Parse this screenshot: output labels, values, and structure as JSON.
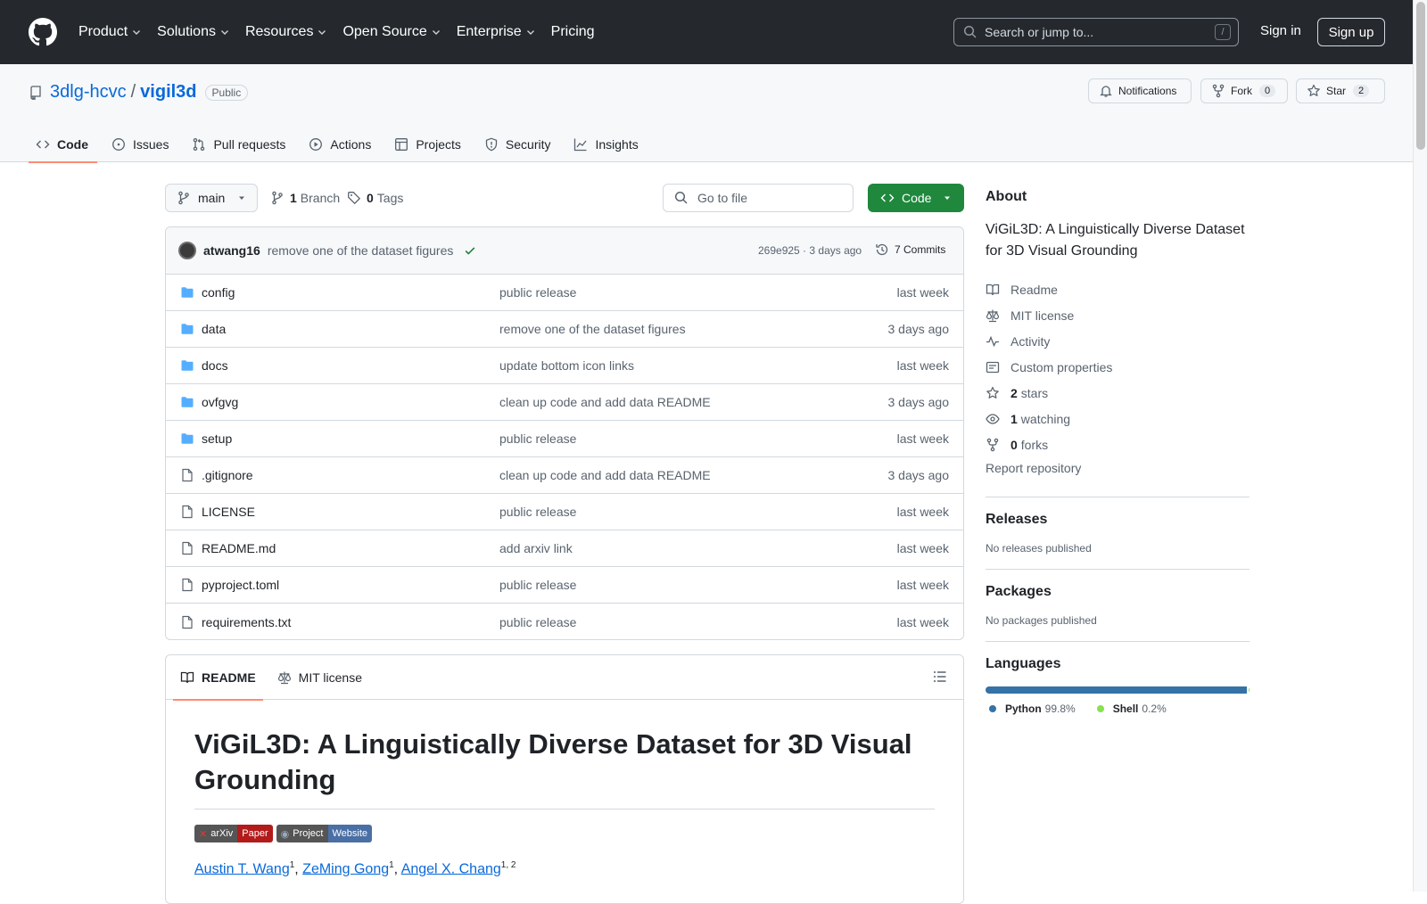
{
  "header": {
    "nav": [
      "Product",
      "Solutions",
      "Resources",
      "Open Source",
      "Enterprise",
      "Pricing"
    ],
    "search_placeholder": "Search or jump to...",
    "search_shortcut": "/",
    "signin": "Sign in",
    "signup": "Sign up"
  },
  "repo": {
    "owner": "3dlg-hcvc",
    "separator": "/",
    "name": "vigil3d",
    "visibility": "Public",
    "notifications_label": "Notifications",
    "fork_label": "Fork",
    "fork_count": "0",
    "star_label": "Star",
    "star_count": "2"
  },
  "tabs": [
    "Code",
    "Issues",
    "Pull requests",
    "Actions",
    "Projects",
    "Security",
    "Insights"
  ],
  "toolbar": {
    "branch": "main",
    "branch_count": "1",
    "branch_label": "Branch",
    "tag_count": "0",
    "tag_label": "Tags",
    "goto_placeholder": "Go to file",
    "code_label": "Code"
  },
  "commit": {
    "author": "atwang16",
    "message": "remove one of the dataset figures",
    "meta": "269e925 · 3 days ago",
    "commits": "7 Commits"
  },
  "files": [
    {
      "name": "config",
      "type": "dir",
      "message": "public release",
      "date": "last week"
    },
    {
      "name": "data",
      "type": "dir",
      "message": "remove one of the dataset figures",
      "date": "3 days ago"
    },
    {
      "name": "docs",
      "type": "dir",
      "message": "update bottom icon links",
      "date": "last week"
    },
    {
      "name": "ovfgvg",
      "type": "dir",
      "message": "clean up code and add data README",
      "date": "3 days ago"
    },
    {
      "name": "setup",
      "type": "dir",
      "message": "public release",
      "date": "last week"
    },
    {
      "name": ".gitignore",
      "type": "file",
      "message": "clean up code and add data README",
      "date": "3 days ago"
    },
    {
      "name": "LICENSE",
      "type": "file",
      "message": "public release",
      "date": "last week"
    },
    {
      "name": "README.md",
      "type": "file",
      "message": "add arxiv link",
      "date": "last week"
    },
    {
      "name": "pyproject.toml",
      "type": "file",
      "message": "public release",
      "date": "last week"
    },
    {
      "name": "requirements.txt",
      "type": "file",
      "message": "public release",
      "date": "last week"
    }
  ],
  "readme": {
    "tab_readme": "README",
    "tab_license": "MIT license",
    "title": "ViGiL3D: A Linguistically Diverse Dataset for 3D Visual Grounding",
    "badge1_left": "arXiv",
    "badge1_right": "Paper",
    "badge1_color": "#b31b1b",
    "badge2_left": "Project",
    "badge2_right": "Website",
    "badge2_color": "#4a6fa5",
    "authors": [
      {
        "name": "Austin T. Wang",
        "sup": "1"
      },
      {
        "name": "ZeMing Gong",
        "sup": "1"
      },
      {
        "name": "Angel X. Chang",
        "sup": "1, 2"
      }
    ]
  },
  "about": {
    "heading": "About",
    "description": "ViGiL3D: A Linguistically Diverse Dataset for 3D Visual Grounding",
    "readme": "Readme",
    "license": "MIT license",
    "activity": "Activity",
    "custom": "Custom properties",
    "stars_count": "2",
    "stars_label": "stars",
    "watching_count": "1",
    "watching_label": "watching",
    "forks_count": "0",
    "forks_label": "forks",
    "report": "Report repository"
  },
  "releases": {
    "heading": "Releases",
    "empty": "No releases published"
  },
  "packages": {
    "heading": "Packages",
    "empty": "No packages published"
  },
  "languages": {
    "heading": "Languages",
    "items": [
      {
        "name": "Python",
        "percent": "99.8%",
        "value": 99.8,
        "color": "#3572A5"
      },
      {
        "name": "Shell",
        "percent": "0.2%",
        "value": 0.2,
        "color": "#89e051"
      }
    ]
  }
}
